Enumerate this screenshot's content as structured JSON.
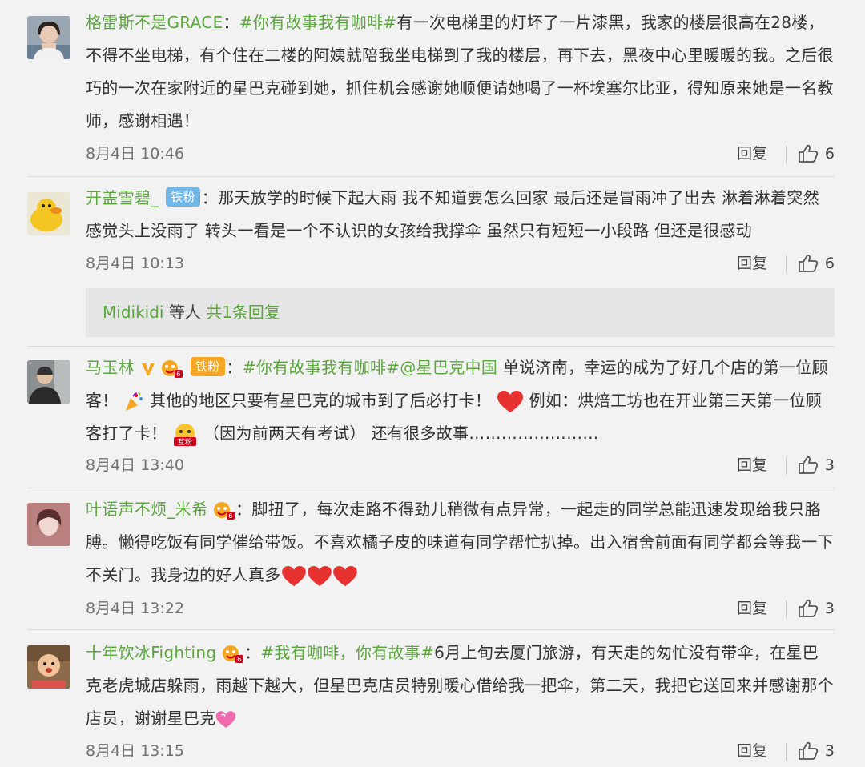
{
  "comments": [
    {
      "name": "格雷斯不是GRACE",
      "colon": "：",
      "topic": "#你有故事我有咖啡#",
      "body": "有一次电梯里的灯坏了一片漆黑，我家的楼层很高在28楼，不得不坐电梯，有个住在二楼的阿姨就陪我坐电梯到了我的楼层，再下去，黑夜中心里暖暖的我。之后很巧的一次在家附近的星巴克碰到她，抓住机会感谢她顺便请她喝了一杯埃塞尔比亚，得知原来她是一名教师，感谢相遇！",
      "date": "8月4日 10:46",
      "reply": "回复",
      "likes": "6"
    },
    {
      "name": "开盖雪碧_",
      "badge": "铁粉",
      "colon": "：",
      "body": "那天放学的时候下起大雨 我不知道要怎么回家 最后还是冒雨冲了出去 淋着淋着突然感觉头上没雨了 转头一看是一个不认识的女孩给我撑伞 虽然只有短短一小段路 但还是很感动",
      "date": "8月4日 10:13",
      "reply": "回复",
      "likes": "6",
      "sub_reply": {
        "user": "Midikidi",
        "middle": " 等人 ",
        "link": "共1条回复"
      }
    },
    {
      "name": "马玉林",
      "badge": "铁粉",
      "colon": "：",
      "topic1": "#你有故事我有咖啡#",
      "mention": "@星巴克中国",
      "body1": " 单说济南，幸运的成为了好几个店的第一位顾客！",
      "body2": " 其他的地区只要有星巴克的城市到了后必打卡！",
      "body3": " 例如：烘焙工坊也在开业第三天第一位顾客打了卡！",
      "body4": "（因为前两天有考试） 还有很多故事……………………",
      "emoji_label": "互粉",
      "date": "8月4日 13:40",
      "reply": "回复",
      "likes": "3"
    },
    {
      "name": "叶语声不烦_米希",
      "colon": "：",
      "body": "脚扭了，每次走路不得劲儿稍微有点异常，一起走的同学总能迅速发现给我只胳膊。懒得吃饭有同学催给带饭。不喜欢橘子皮的味道有同学帮忙扒掉。出入宿舍前面有同学都会等我一下不关门。我身边的好人真多",
      "date": "8月4日 13:22",
      "reply": "回复",
      "likes": "3"
    },
    {
      "name": "十年饮冰Fighting",
      "colon": "：",
      "topic": "#我有咖啡，你有故事#",
      "body": "6月上旬去厦门旅游，有天走的匆忙没有带伞，在星巴克老虎城店躲雨，雨越下越大，但星巴克店员特别暖心借给我一把伞，第二天，我把它送回来并感谢那个店员，谢谢星巴克",
      "date": "8月4日 13:15",
      "reply": "回复",
      "likes": "3"
    }
  ],
  "colors": {
    "name": "#5ba63d",
    "badge": "#70b7e8",
    "text": "#333333",
    "meta": "#707070",
    "heart": "#e8322f"
  },
  "icons": [
    "like-icon",
    "fan-badge-icon",
    "party-popper-icon",
    "heart-icon",
    "vip-v-icon",
    "emoji-hu-fen-icon",
    "sparkling-heart-icon"
  ]
}
